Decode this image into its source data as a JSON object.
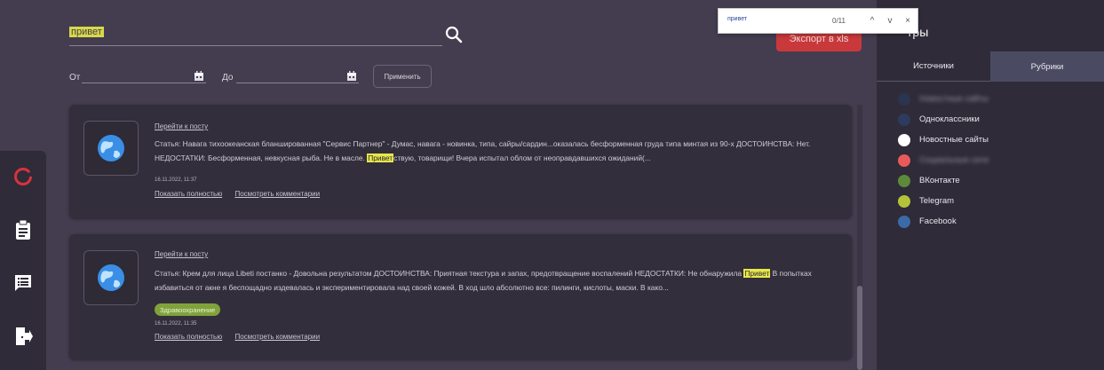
{
  "search": {
    "value": "привет"
  },
  "header": {
    "export_label": "Экспорт в xls"
  },
  "filters": {
    "from_label": "От",
    "to_label": "До",
    "apply_label": "Применить"
  },
  "posts": [
    {
      "link_label": "Перейти к посту",
      "text_before": "Статья: Навага тихоокеанская бланшированная \"Сервис Партнер\" - Думас, навага - новинка, типа, сайры/сардин...оказалась бесформенная груда типа минтая из 90-х ДОСТОИНСТВА: Нет. НЕДОСТАТКИ: Бесформенная, невкусная рыба. Не в масле.",
      "highlight": "Привет",
      "text_after": "ствую, товарищи! Вчера испытал облом от неоправдавшихся ожиданий(...",
      "date": "16.11.2022, 11:37",
      "show_full_label": "Показать полностью",
      "comments_label": "Посмотреть комментарии"
    },
    {
      "link_label": "Перейти к посту",
      "text_before": "Статья: Крем для лица Libeti постанко - Довольна результатом ДОСТОИНСТВА: Приятная текстура и запах, предотвращение воспалений НЕДОСТАТКИ: Не обнаружила",
      "highlight": "Привет",
      "text_after": "В попытках избавиться от акне я беспощадно издевалась и экспериментировала над своей кожей. В ход шло абсолютно все: пилинги, кислоты, маски. В како...",
      "tag": "Здравоохранение",
      "date": "16.11.2022, 11:35",
      "show_full_label": "Показать полностью",
      "comments_label": "Посмотреть комментарии"
    }
  ],
  "findbar": {
    "query": "привет",
    "count": "0/11",
    "up": "^",
    "down": "v",
    "close": "×"
  },
  "right_panel": {
    "title": "тры",
    "tabs": [
      "Источники",
      "Рубрики"
    ],
    "sources": [
      {
        "label": "Новостные сайты",
        "color": "#2a3550",
        "blurred": true
      },
      {
        "label": "Одноклассники",
        "color": "#2d3b60",
        "blurred": false
      },
      {
        "label": "Новостные сайты",
        "color": "#ffffff",
        "blurred": false
      },
      {
        "label": "Социальные сети",
        "color": "#e85a5a",
        "blurred": true
      },
      {
        "label": "ВКонтакте",
        "color": "#5c8a3a",
        "blurred": false
      },
      {
        "label": "Telegram",
        "color": "#b5c33a",
        "blurred": false
      },
      {
        "label": "Facebook",
        "color": "#3a6aa8",
        "blurred": false
      }
    ]
  },
  "icons": {
    "rail": [
      "logo-ring-icon",
      "clipboard-icon",
      "chat-list-icon",
      "logout-icon"
    ],
    "search": "search-icon",
    "calendar": "calendar-icon",
    "globe": "globe-icon"
  },
  "colors": {
    "accent": "#c9383b",
    "highlight": "#e6e84a",
    "tag": "#7fa33a"
  }
}
